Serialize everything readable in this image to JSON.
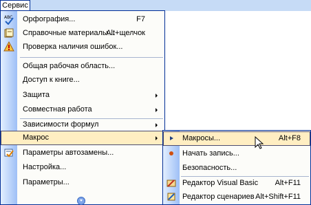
{
  "menubar": {
    "title": "Сервис"
  },
  "main_menu": {
    "items": [
      {
        "label": "Орфография...",
        "shortcut": "F7",
        "icon": "spelling-icon"
      },
      {
        "label": "Справочные материалы...",
        "shortcut": "Alt+щелчок",
        "icon": "research-icon"
      },
      {
        "label": "Проверка наличия ошибок...",
        "shortcut": "",
        "icon": "error-check-icon"
      },
      {
        "label": "Общая рабочая область...",
        "shortcut": ""
      },
      {
        "label": "Доступ к книге...",
        "shortcut": ""
      },
      {
        "label": "Защита",
        "shortcut": "",
        "submenu": true
      },
      {
        "label": "Совместная работа",
        "shortcut": "",
        "submenu": true
      },
      {
        "label": "Зависимости формул",
        "shortcut": "",
        "submenu": true
      },
      {
        "label": "Макрос",
        "shortcut": "",
        "submenu": true
      },
      {
        "label": "Параметры автозамены...",
        "shortcut": "",
        "icon": "autocorrect-icon"
      },
      {
        "label": "Настройка...",
        "shortcut": ""
      },
      {
        "label": "Параметры...",
        "shortcut": ""
      }
    ]
  },
  "sub_menu": {
    "items": [
      {
        "label": "Макросы...",
        "shortcut": "Alt+F8",
        "icon": "play-icon"
      },
      {
        "label": "Начать запись...",
        "shortcut": "",
        "icon": "record-icon"
      },
      {
        "label": "Безопасность...",
        "shortcut": ""
      },
      {
        "label": "Редактор Visual Basic",
        "shortcut": "Alt+F11",
        "icon": "vb-editor-icon"
      },
      {
        "label": "Редактор сценариев",
        "shortcut": "Alt+Shift+F11",
        "icon": "script-editor-icon"
      }
    ]
  },
  "colors": {
    "accent": "#002d96",
    "highlight": "#ffeec2",
    "gutter_start": "#e3efff",
    "gutter_end": "#9ebff6"
  }
}
